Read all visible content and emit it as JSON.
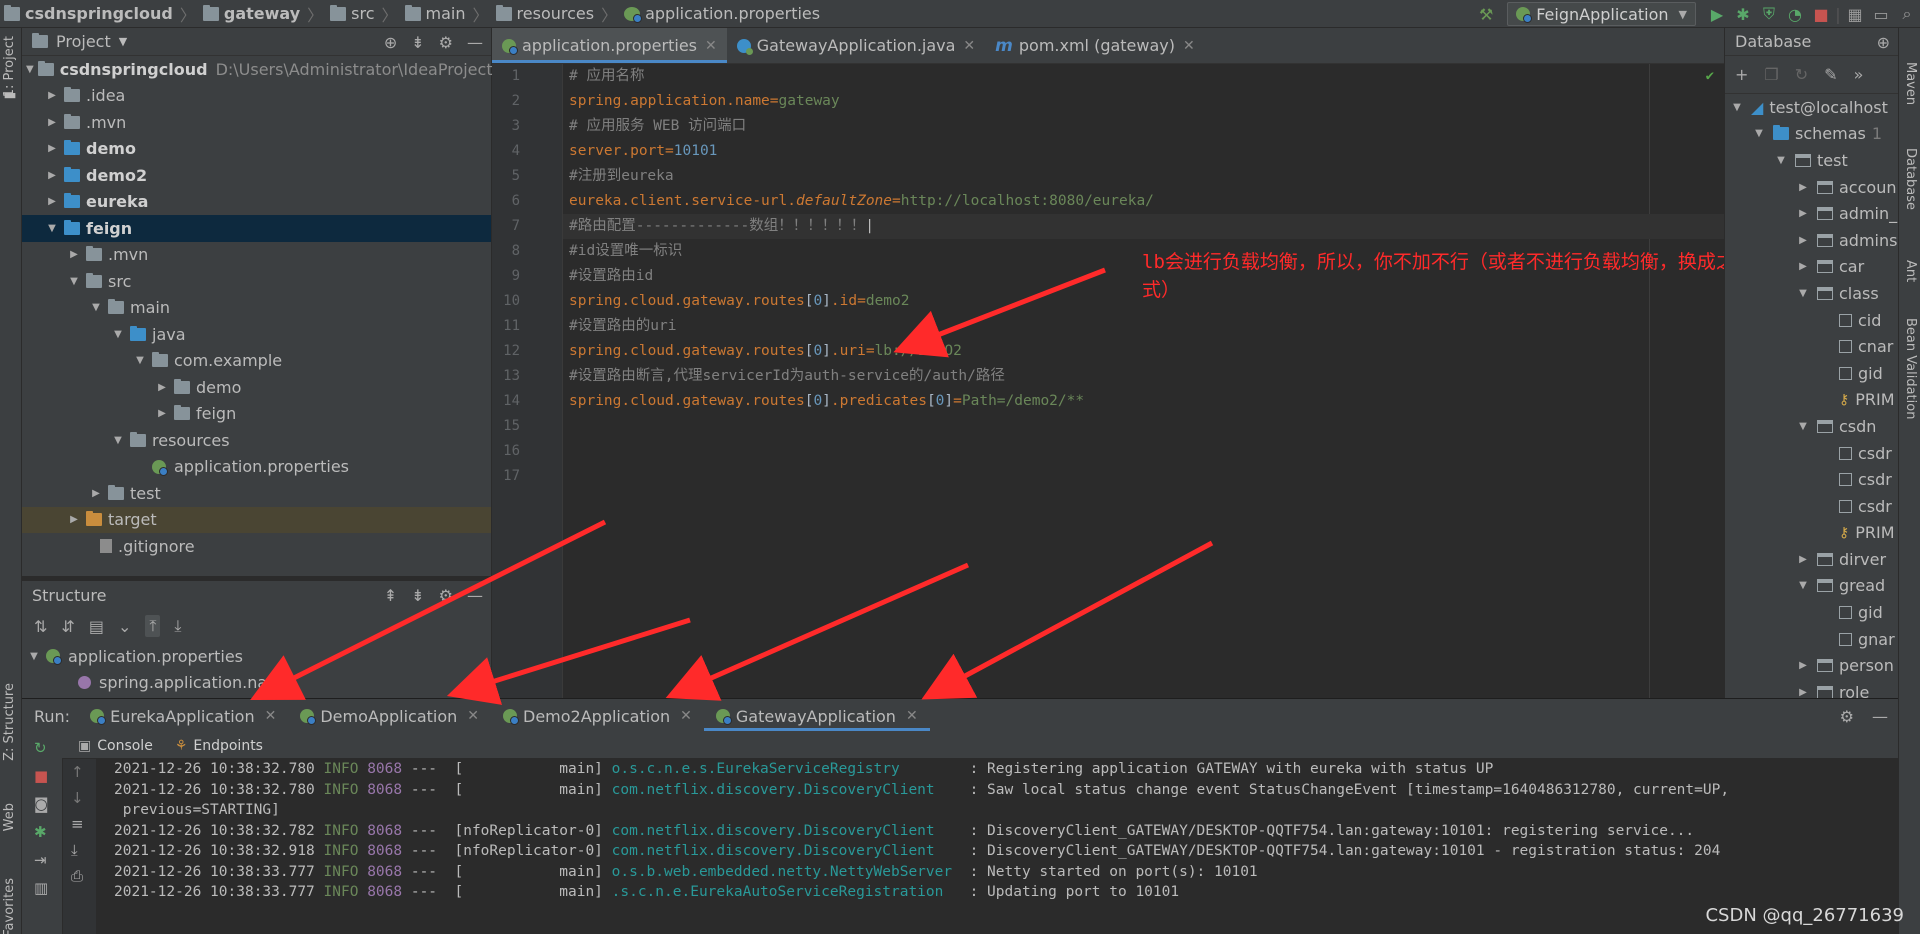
{
  "breadcrumbs": [
    "csdnspringcloud",
    "gateway",
    "src",
    "main",
    "resources",
    "application.properties"
  ],
  "run_config": "FeignApplication",
  "left_strip": {
    "project_tab": "1: Project",
    "structure_tab": "Z: Structure",
    "web_tab": "Web",
    "favorites_tab": "Favorites"
  },
  "right_strip": {
    "maven": "Maven",
    "database": "Database",
    "ant": "Ant",
    "bean_validation": "Bean Validation"
  },
  "project": {
    "title": "Project",
    "root_name": "csdnspringcloud",
    "root_path": "D:\\Users\\Administrator\\IdeaProjects\\cs",
    "items": [
      ".idea",
      ".mvn",
      "demo",
      "demo2",
      "eureka",
      "feign",
      ".mvn",
      "src",
      "main",
      "java",
      "com.example",
      "demo",
      "feign",
      "resources",
      "application.properties",
      "test",
      "target",
      ".gitignore"
    ]
  },
  "structure": {
    "title": "Structure",
    "root": "application.properties",
    "item": "spring.application.name"
  },
  "editor_tabs": [
    {
      "label": "application.properties"
    },
    {
      "label": "GatewayApplication.java"
    },
    {
      "label": "pom.xml (gateway)"
    }
  ],
  "code": {
    "line_numbers": [
      "1",
      "2",
      "3",
      "4",
      "5",
      "6",
      "7",
      "8",
      "9",
      "10",
      "11",
      "12",
      "13",
      "14",
      "15",
      "16",
      "17"
    ],
    "l1": "# 应用名称",
    "l2k": "spring.application.name",
    "l2v": "gateway",
    "l3": "# 应用服务 WEB 访问端口",
    "l4k": "server.port",
    "l4v": "10101",
    "l5": "#注册到eureka",
    "l6k": "eureka.client.service-url.",
    "l6ki": "defaultZone",
    "l6v": "http://localhost:8080/eureka/",
    "l7": "#路由配置-------------数组！！！！！！",
    "l8": "#id设置唯一标识",
    "l9": "#设置路由id",
    "l10k": "spring.cloud.gateway.routes",
    "l10i": "0",
    "l10k2": ".id",
    "l10v": "demo2",
    "l11": "#设置路由的uri",
    "l12k": "spring.cloud.gateway.routes",
    "l12i": "0",
    "l12k2": ".uri",
    "l12v": "lb://DEMO2",
    "l13": "#设置路由断言,代理servicerId为auth-service的/auth/路径",
    "l14k": "spring.cloud.gateway.routes",
    "l14i": "0",
    "l14k2": ".predicates",
    "l14i2": "0",
    "l14v": "Path=/demo2/**"
  },
  "annotation": {
    "line1": "lb会进行负载均衡，所以，你不加不行（或者不进行负载均衡，换成之前的路径端口样",
    "line2": "式）"
  },
  "database": {
    "title": "Database",
    "connection": "test@localhost",
    "schemas": "schemas",
    "schemas_count": "1",
    "schema": "test",
    "rows": [
      "accoun",
      "admin_",
      "admins",
      "car",
      "class",
      "cid",
      "cnar",
      "gid",
      "PRIM",
      "csdn",
      "csdr",
      "csdr",
      "csdr",
      "PRIM",
      "dirver",
      "gread",
      "gid",
      "gnar",
      "person",
      "role"
    ]
  },
  "run": {
    "label": "Run:",
    "tabs": [
      "EurekaApplication",
      "DemoApplication",
      "Demo2Application",
      "GatewayApplication"
    ],
    "subtabs": [
      "Console",
      "Endpoints"
    ],
    "logs": [
      {
        "ts": "2021-12-26 10:38:32.780",
        "lvl": "INFO",
        "pid": "8068",
        "thread": "---  [           main]",
        "logger": "o.s.c.n.e.s.EurekaServiceRegistry       ",
        "msg": " : Registering application GATEWAY with eureka with status UP"
      },
      {
        "ts": "2021-12-26 10:38:32.780",
        "lvl": "INFO",
        "pid": "8068",
        "thread": "---  [           main]",
        "logger": "com.netflix.discovery.DiscoveryClient   ",
        "msg": " : Saw local status change event StatusChangeEvent [timestamp=1640486312780, current=UP,"
      },
      {
        "ts": "",
        "lvl": "",
        "pid": "",
        "thread": "",
        "logger": "",
        "msg": " previous=STARTING]"
      },
      {
        "ts": "2021-12-26 10:38:32.782",
        "lvl": "INFO",
        "pid": "8068",
        "thread": "---  [nfoReplicator-0]",
        "logger": "com.netflix.discovery.DiscoveryClient   ",
        "msg": " : DiscoveryClient_GATEWAY/DESKTOP-QQTF754.lan:gateway:10101: registering service..."
      },
      {
        "ts": "2021-12-26 10:38:32.918",
        "lvl": "INFO",
        "pid": "8068",
        "thread": "---  [nfoReplicator-0]",
        "logger": "com.netflix.discovery.DiscoveryClient   ",
        "msg": " : DiscoveryClient_GATEWAY/DESKTOP-QQTF754.lan:gateway:10101 - registration status: 204"
      },
      {
        "ts": "2021-12-26 10:38:33.777",
        "lvl": "INFO",
        "pid": "8068",
        "thread": "---  [           main]",
        "logger": "o.s.b.web.embedded.netty.NettyWebServer ",
        "msg": " : Netty started on port(s): 10101"
      },
      {
        "ts": "2021-12-26 10:38:33.777",
        "lvl": "INFO",
        "pid": "8068",
        "thread": "---  [           main]",
        "logger": ".s.c.n.e.EurekaAutoServiceRegistration  ",
        "msg": " : Updating port to 10101"
      }
    ]
  },
  "watermark": "CSDN @qq_26771639",
  "colors": {
    "accent": "#4a88c7",
    "annotation": "#ff2a2a"
  }
}
